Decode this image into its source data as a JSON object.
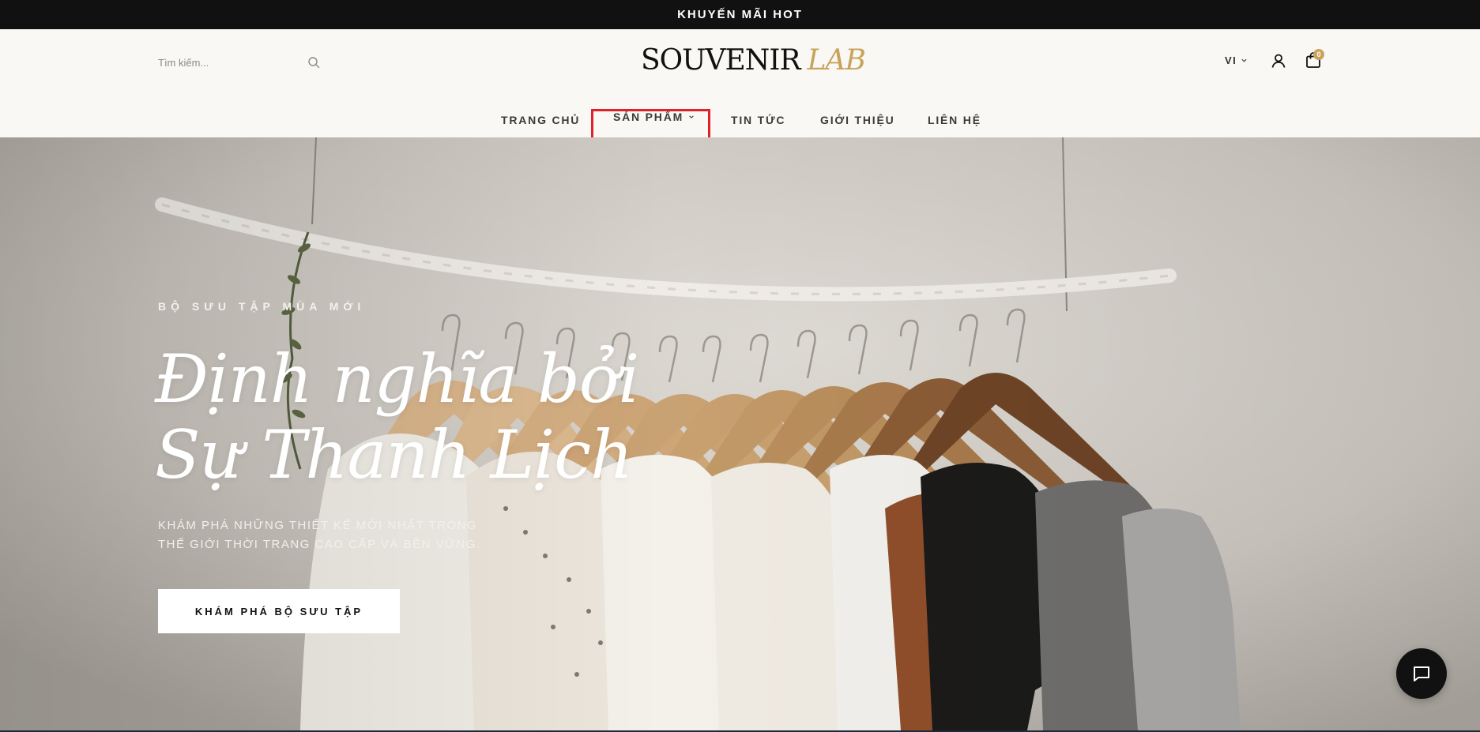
{
  "promo": {
    "text": "KHUYẾN MÃI HOT"
  },
  "header": {
    "search": {
      "placeholder": "Tìm kiếm...",
      "icon": "search-icon"
    },
    "logo": {
      "part1": "SOUVENIR",
      "part2": "LAB"
    },
    "language": {
      "label": "VI",
      "icon": "chevron-down-icon"
    },
    "account": {
      "icon": "user-icon"
    },
    "cart": {
      "icon": "shopping-bag-icon",
      "count": "0"
    },
    "colors": {
      "accent": "#c9a35c",
      "background": "#f9f8f4",
      "highlight_box": "#e0202a"
    }
  },
  "nav": {
    "items": [
      {
        "label": "TRANG CHỦ"
      },
      {
        "label": "SẢN PHẨM",
        "has_dropdown": true
      },
      {
        "label": "TIN TỨC"
      },
      {
        "label": "GIỚI THIỆU"
      },
      {
        "label": "LIÊN HỆ"
      }
    ]
  },
  "hero": {
    "eyebrow": "BỘ SƯU TẬP MÙA MỚI",
    "headline_line1": "Định nghĩa bởi",
    "headline_line2": "Sự Thanh Lịch",
    "subtitle_line1": "KHÁM PHÁ NHỮNG THIẾT KẾ MỚI NHẤT TRONG",
    "subtitle_line2": "THẾ GIỚI THỜI TRANG CAO CẤP VÀ BỀN VỮNG.",
    "cta_label": "KHÁM PHÁ BỘ SƯU TẬP",
    "image": "clothing-rack-photo"
  },
  "chat": {
    "icon": "chat-bubble-icon"
  }
}
